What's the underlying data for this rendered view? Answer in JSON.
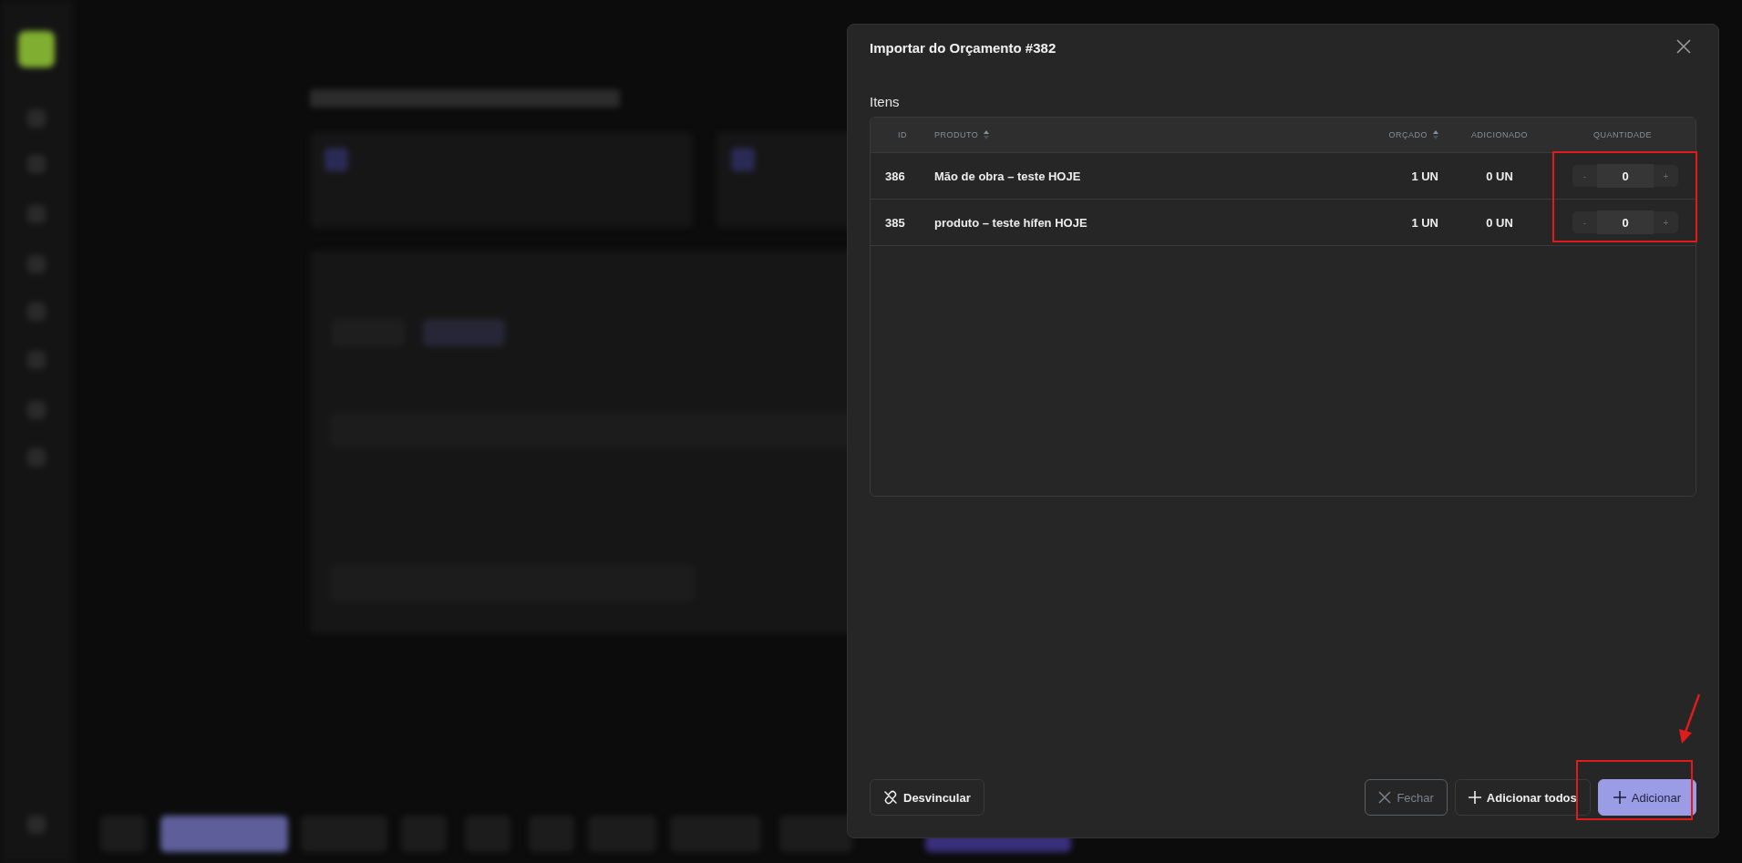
{
  "dialog": {
    "title": "Importar do Orçamento #382",
    "section_label": "Itens",
    "table": {
      "columns": [
        {
          "label": "ID",
          "kind": "plain"
        },
        {
          "label": "PRODUTO",
          "kind": "sortable"
        },
        {
          "label": "ORÇADO",
          "kind": "sortable"
        },
        {
          "label": "ADICIONADO",
          "kind": "plain"
        },
        {
          "label": "QUANTIDADE",
          "kind": "plain"
        }
      ],
      "rows": [
        {
          "id": "386",
          "product": "Mão de obra – teste HOJE",
          "budgeted": "1 UN",
          "added": "0 UN",
          "quantity": "0",
          "decrement": "-",
          "increment": "+"
        },
        {
          "id": "385",
          "product": "produto – teste hífen HOJE",
          "budgeted": "1 UN",
          "added": "0 UN",
          "quantity": "0",
          "decrement": "-",
          "increment": "+"
        }
      ]
    },
    "buttons": [
      {
        "label": "Desvincular",
        "kind": "unlink",
        "disabled": false
      },
      {
        "label": "Fechar",
        "kind": "close",
        "disabled": true
      },
      {
        "label": "Adicionar todos",
        "kind": "add-all",
        "disabled": false
      },
      {
        "label": "Adicionar",
        "kind": "primary",
        "disabled": false
      }
    ]
  }
}
